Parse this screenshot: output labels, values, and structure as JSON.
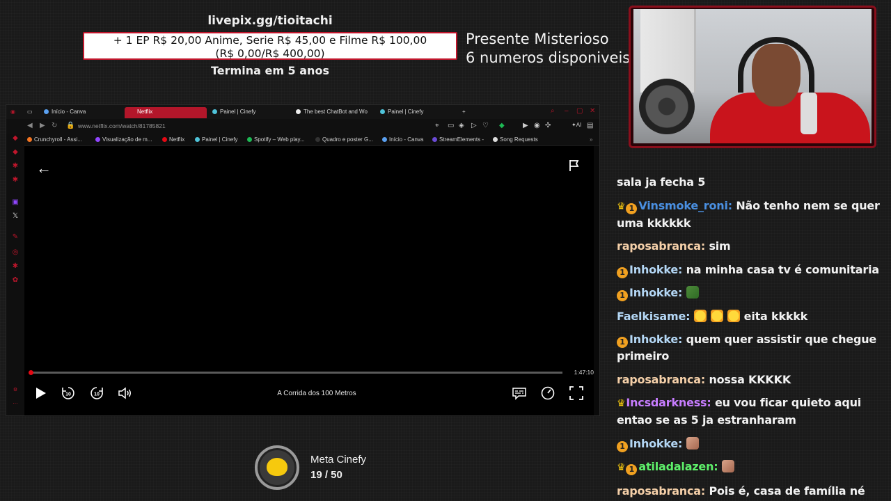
{
  "overlay": {
    "pix_url": "livepix.gg/tioitachi",
    "pix_line1": "+ 1 EP R$ 20,00 Anime, Serie R$ 45,00 e Filme R$ 100,00",
    "pix_line2": "(R$ 0,00/R$ 400,00)",
    "pix_ends": "Termina em 5 anos",
    "mystery_line1": "Presente Misterioso",
    "mystery_line2": "6 numeros disponiveis"
  },
  "browser": {
    "tabs": [
      {
        "label": "Início - Canva"
      },
      {
        "label": "Netflix"
      },
      {
        "label": "Painel | Cinefy"
      },
      {
        "label": "The best ChatBot and Wo"
      },
      {
        "label": "Painel | Cinefy"
      }
    ],
    "url": "www.netflix.com/watch/81785821",
    "bookmarks": [
      {
        "label": "Crunchyroll - Assi...",
        "color": "#f47521"
      },
      {
        "label": "Visualização de m...",
        "color": "#9146ff"
      },
      {
        "label": "Netflix",
        "color": "#e50914"
      },
      {
        "label": "Painel | Cinefy",
        "color": "#5aa0f0"
      },
      {
        "label": "Spotify – Web play...",
        "color": "#1db954"
      },
      {
        "label": "Quadro e poster G...",
        "color": "#333333"
      },
      {
        "label": "Início - Canva",
        "color": "#5aa0f0"
      },
      {
        "label": "StreamElements -",
        "color": "#6b4bd6"
      },
      {
        "label": "Song Requests",
        "color": "#dddddd"
      }
    ],
    "player": {
      "time_remaining": "1:47:10",
      "title": "A Corrida dos 100 Metros",
      "progress": 0.005
    }
  },
  "goal": {
    "label": "Meta Cinefy",
    "count": "19 / 50"
  },
  "chat": {
    "colors": {
      "blue": "#4a90e2",
      "cream": "#f5d0a9",
      "lightblue": "#b4d7f5",
      "purple": "#c77dff",
      "green": "#5ef06a"
    },
    "messages": [
      {
        "user": "",
        "text": "sala ja fecha 5",
        "color": "#f2f2f2",
        "badges": ""
      },
      {
        "user": "Vinsmoke_roni:",
        "text": "Não tenho nem se quer uma kkkkkk",
        "color": "#4a90e2",
        "badges": "crown1"
      },
      {
        "user": "raposabranca:",
        "text": "sim",
        "color": "#f5d0a9",
        "badges": ""
      },
      {
        "user": "Inhokke:",
        "text": "na minha casa tv é comunitaria",
        "color": "#b4d7f5",
        "badges": "1"
      },
      {
        "user": "Inhokke:",
        "text": "",
        "color": "#b4d7f5",
        "badges": "1",
        "emote": "pepe"
      },
      {
        "user": "Faelkisame:",
        "text": "eita kkkkk",
        "color": "#b4d7f5",
        "badges": "",
        "emote": "shock3"
      },
      {
        "user": "Inhokke:",
        "text": "quem quer assistir que chegue primeiro",
        "color": "#b4d7f5",
        "badges": "1"
      },
      {
        "user": "raposabranca:",
        "text": "nossa KKKKK",
        "color": "#f5d0a9",
        "badges": ""
      },
      {
        "user": "Incsdarkness:",
        "text": "eu vou ficar quieto aqui entao se as 5 ja estranharam",
        "color": "#c77dff",
        "badges": "crown"
      },
      {
        "user": "Inhokke:",
        "text": "",
        "color": "#b4d7f5",
        "badges": "1",
        "emote": "face"
      },
      {
        "user": "atiladalazen:",
        "text": "",
        "color": "#5ef06a",
        "badges": "crown1",
        "emote": "face"
      },
      {
        "user": "raposabranca:",
        "text": "Pois é, casa de família né",
        "color": "#f5d0a9",
        "badges": "",
        "emote_after": "gray"
      }
    ]
  }
}
